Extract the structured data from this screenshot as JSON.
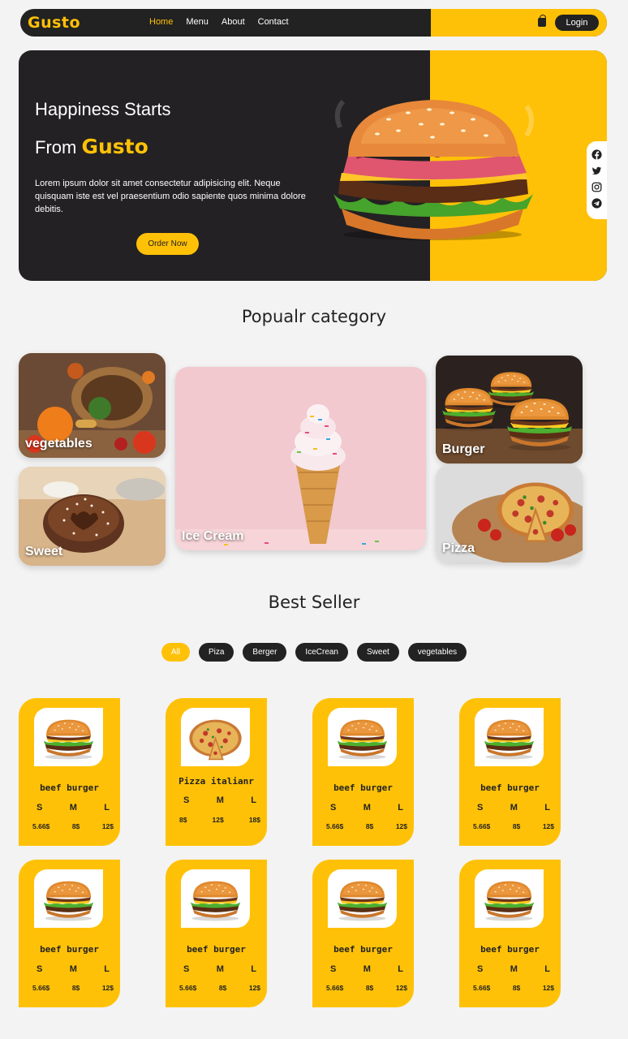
{
  "nav": {
    "logo": "Gusto",
    "links": [
      "Home",
      "Menu",
      "About",
      "Contact"
    ],
    "login_label": "Login"
  },
  "hero": {
    "line1": "Happiness Starts",
    "line2_prefix": "From",
    "line2_brand": "Gusto",
    "paragraph": "Lorem ipsum dolor sit amet consectetur adipisicing elit. Neque quisquam iste est vel praesentium odio sapiente quos minima dolore debitis.",
    "cta_label": "Order Now",
    "social_icons": [
      "facebook-icon",
      "twitter-icon",
      "instagram-icon",
      "telegram-icon"
    ]
  },
  "categories": {
    "title": "Popualr category",
    "items": [
      "vegetables",
      "Sweet",
      "Ice Cream",
      "Burger",
      "Pizza"
    ]
  },
  "best_seller": {
    "title": "Best Seller",
    "filters": [
      "All",
      "Piza",
      "Berger",
      "IceCrean",
      "Sweet",
      "vegetables"
    ],
    "active_filter": "All",
    "size_labels": [
      "S",
      "M",
      "L"
    ],
    "products": [
      {
        "name": "beef burger",
        "prices": [
          "5.66$",
          "8$",
          "12$"
        ],
        "image": "burger"
      },
      {
        "name": "Pizza italianr",
        "prices": [
          "8$",
          "12$",
          "18$"
        ],
        "image": "pizza"
      },
      {
        "name": "beef burger",
        "prices": [
          "5.66$",
          "8$",
          "12$"
        ],
        "image": "burger"
      },
      {
        "name": "beef burger",
        "prices": [
          "5.66$",
          "8$",
          "12$"
        ],
        "image": "burger"
      },
      {
        "name": "beef burger",
        "prices": [
          "5.66$",
          "8$",
          "12$"
        ],
        "image": "burger"
      },
      {
        "name": "beef burger",
        "prices": [
          "5.66$",
          "8$",
          "12$"
        ],
        "image": "burger"
      },
      {
        "name": "beef burger",
        "prices": [
          "5.66$",
          "8$",
          "12$"
        ],
        "image": "burger"
      },
      {
        "name": "beef burger",
        "prices": [
          "5.66$",
          "8$",
          "12$"
        ],
        "image": "burger"
      }
    ]
  },
  "colors": {
    "accent": "#ffc107",
    "dark": "#222222",
    "background": "#f3f3f3"
  }
}
